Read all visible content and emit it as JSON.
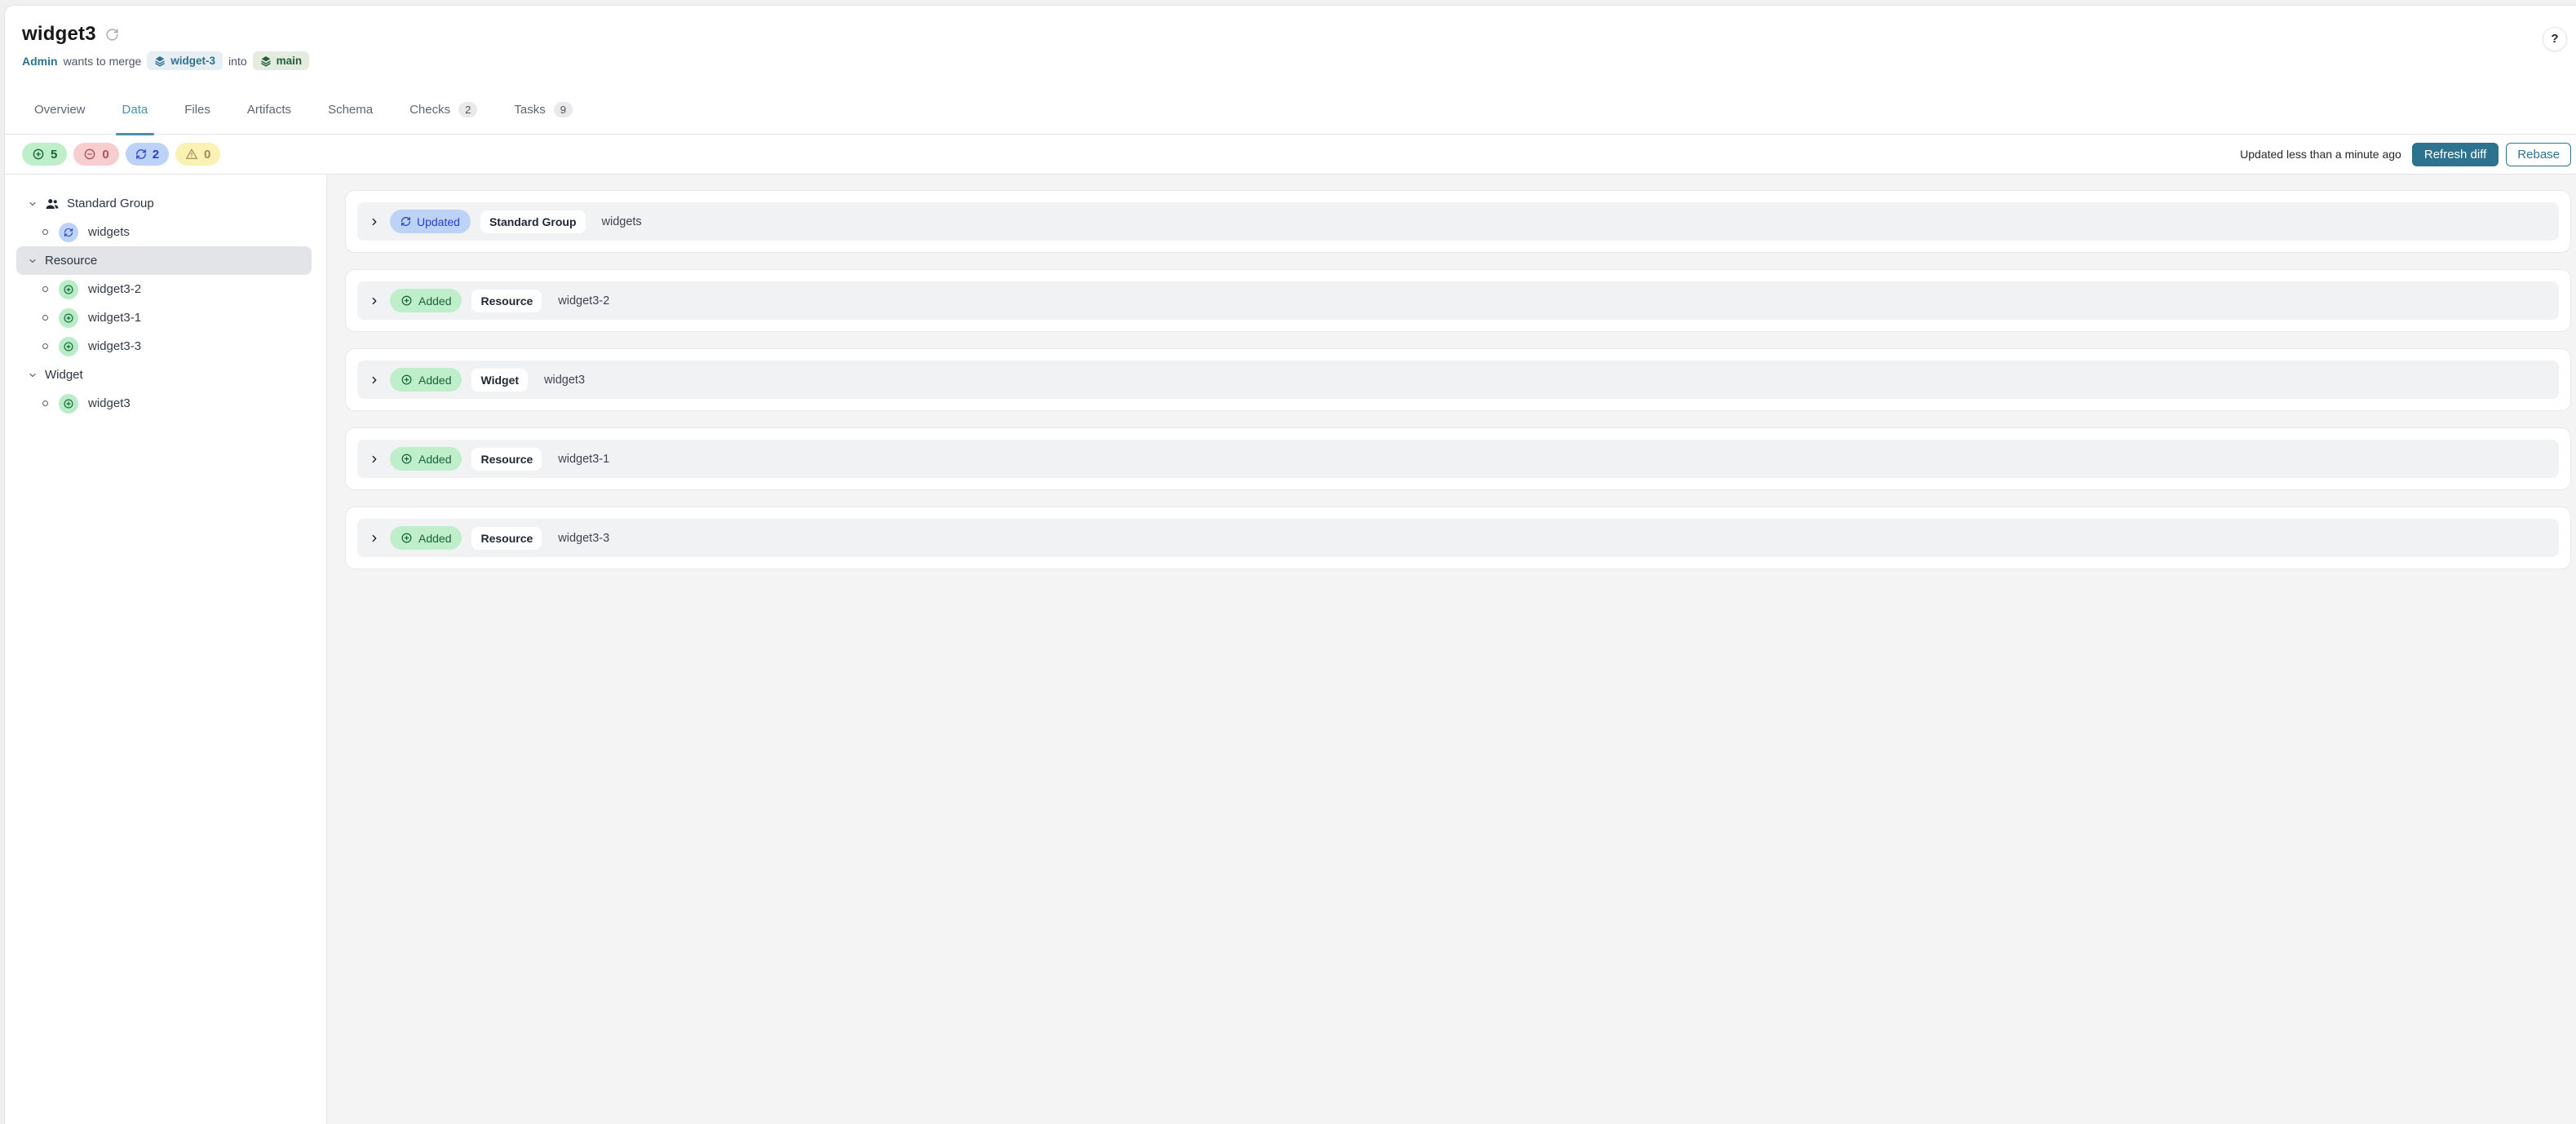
{
  "header": {
    "title": "widget3",
    "author": "Admin",
    "merge_text": "wants to merge",
    "source_branch": "widget-3",
    "into_text": "into",
    "target_branch": "main",
    "help_label": "?"
  },
  "tabs": [
    {
      "label": "Overview"
    },
    {
      "label": "Data",
      "active": true
    },
    {
      "label": "Files"
    },
    {
      "label": "Artifacts"
    },
    {
      "label": "Schema"
    },
    {
      "label": "Checks",
      "count": "2"
    },
    {
      "label": "Tasks",
      "count": "9"
    }
  ],
  "stats": {
    "added": "5",
    "removed": "0",
    "updated": "2",
    "warnings": "0",
    "updated_text": "Updated less than a minute ago",
    "refresh_button": "Refresh diff",
    "rebase_button": "Rebase"
  },
  "sidebar": {
    "items": [
      {
        "type": "group",
        "label": "Standard Group",
        "icon": "users"
      },
      {
        "type": "child",
        "label": "widgets",
        "change": "updated"
      },
      {
        "type": "group",
        "label": "Resource",
        "selected": true
      },
      {
        "type": "child",
        "label": "widget3-2",
        "change": "added"
      },
      {
        "type": "child",
        "label": "widget3-1",
        "change": "added"
      },
      {
        "type": "child",
        "label": "widget3-3",
        "change": "added"
      },
      {
        "type": "group",
        "label": "Widget"
      },
      {
        "type": "child",
        "label": "widget3",
        "change": "added"
      }
    ]
  },
  "cards": [
    {
      "status": "Updated",
      "type": "Standard Group",
      "name": "widgets"
    },
    {
      "status": "Added",
      "type": "Resource",
      "name": "widget3-2"
    },
    {
      "status": "Added",
      "type": "Widget",
      "name": "widget3"
    },
    {
      "status": "Added",
      "type": "Resource",
      "name": "widget3-1"
    },
    {
      "status": "Added",
      "type": "Resource",
      "name": "widget3-3"
    }
  ],
  "colors": {
    "accent_teal": "#2d7390",
    "tab_active": "#4a90ac",
    "added_bg": "#bfeecb",
    "added_text": "#166534",
    "removed_bg": "#f7cdd0",
    "removed_text": "#a85454",
    "updated_bg": "#bcd2f7",
    "updated_text": "#2742c0",
    "warning_bg": "#f9f2b4",
    "warning_text": "#a08a52",
    "selected_row_bg": "#e3e4e8",
    "source_badge_bg": "#e7eef4",
    "target_badge_bg": "#e4ecdf",
    "target_badge_text": "#235e38"
  }
}
